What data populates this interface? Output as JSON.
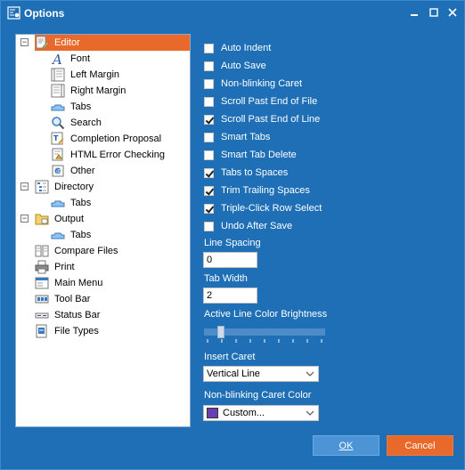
{
  "window": {
    "title": "Options"
  },
  "tree": {
    "items": [
      {
        "label": "Editor",
        "icon": "document-edit-icon",
        "expander": "−",
        "selected": true
      },
      {
        "label": "Font",
        "icon": "font-icon"
      },
      {
        "label": "Left Margin",
        "icon": "left-margin-icon"
      },
      {
        "label": "Right Margin",
        "icon": "right-margin-icon"
      },
      {
        "label": "Tabs",
        "icon": "tabs-icon"
      },
      {
        "label": "Search",
        "icon": "search-icon"
      },
      {
        "label": "Completion Proposal",
        "icon": "completion-icon"
      },
      {
        "label": "HTML Error Checking",
        "icon": "html-check-icon"
      },
      {
        "label": "Other",
        "icon": "other-icon"
      },
      {
        "label": "Directory",
        "icon": "directory-icon",
        "expander": "−"
      },
      {
        "label": "Tabs",
        "icon": "tabs-icon"
      },
      {
        "label": "Output",
        "icon": "output-icon",
        "expander": "−"
      },
      {
        "label": "Tabs",
        "icon": "tabs-icon"
      },
      {
        "label": "Compare Files",
        "icon": "compare-icon"
      },
      {
        "label": "Print",
        "icon": "printer-icon"
      },
      {
        "label": "Main Menu",
        "icon": "menu-icon"
      },
      {
        "label": "Tool Bar",
        "icon": "toolbar-icon"
      },
      {
        "label": "Status Bar",
        "icon": "statusbar-icon"
      },
      {
        "label": "File Types",
        "icon": "file-types-icon"
      }
    ]
  },
  "options": {
    "checkboxes": [
      {
        "label": "Auto Indent",
        "checked": false
      },
      {
        "label": "Auto Save",
        "checked": false
      },
      {
        "label": "Non-blinking Caret",
        "checked": false
      },
      {
        "label": "Scroll Past End of File",
        "checked": false
      },
      {
        "label": "Scroll Past End of Line",
        "checked": true
      },
      {
        "label": "Smart Tabs",
        "checked": false
      },
      {
        "label": "Smart Tab Delete",
        "checked": false
      },
      {
        "label": "Tabs to Spaces",
        "checked": true
      },
      {
        "label": "Trim Trailing Spaces",
        "checked": true
      },
      {
        "label": "Triple-Click Row Select",
        "checked": true
      },
      {
        "label": "Undo After Save",
        "checked": false
      }
    ],
    "line_spacing": {
      "label": "Line Spacing",
      "value": "0"
    },
    "tab_width": {
      "label": "Tab Width",
      "value": "2"
    },
    "brightness": {
      "label": "Active Line Color Brightness",
      "level_fraction": 0.12
    },
    "insert_caret": {
      "label": "Insert Caret",
      "value": "Vertical Line"
    },
    "caret_color": {
      "label": "Non-blinking Caret Color",
      "value": "Custom...",
      "swatch": "#6a3fb0"
    }
  },
  "buttons": {
    "ok": "OK",
    "cancel": "Cancel"
  },
  "colors": {
    "window": "#1e6fb5",
    "accent": "#e8692a",
    "ok": "#4d94d6"
  }
}
